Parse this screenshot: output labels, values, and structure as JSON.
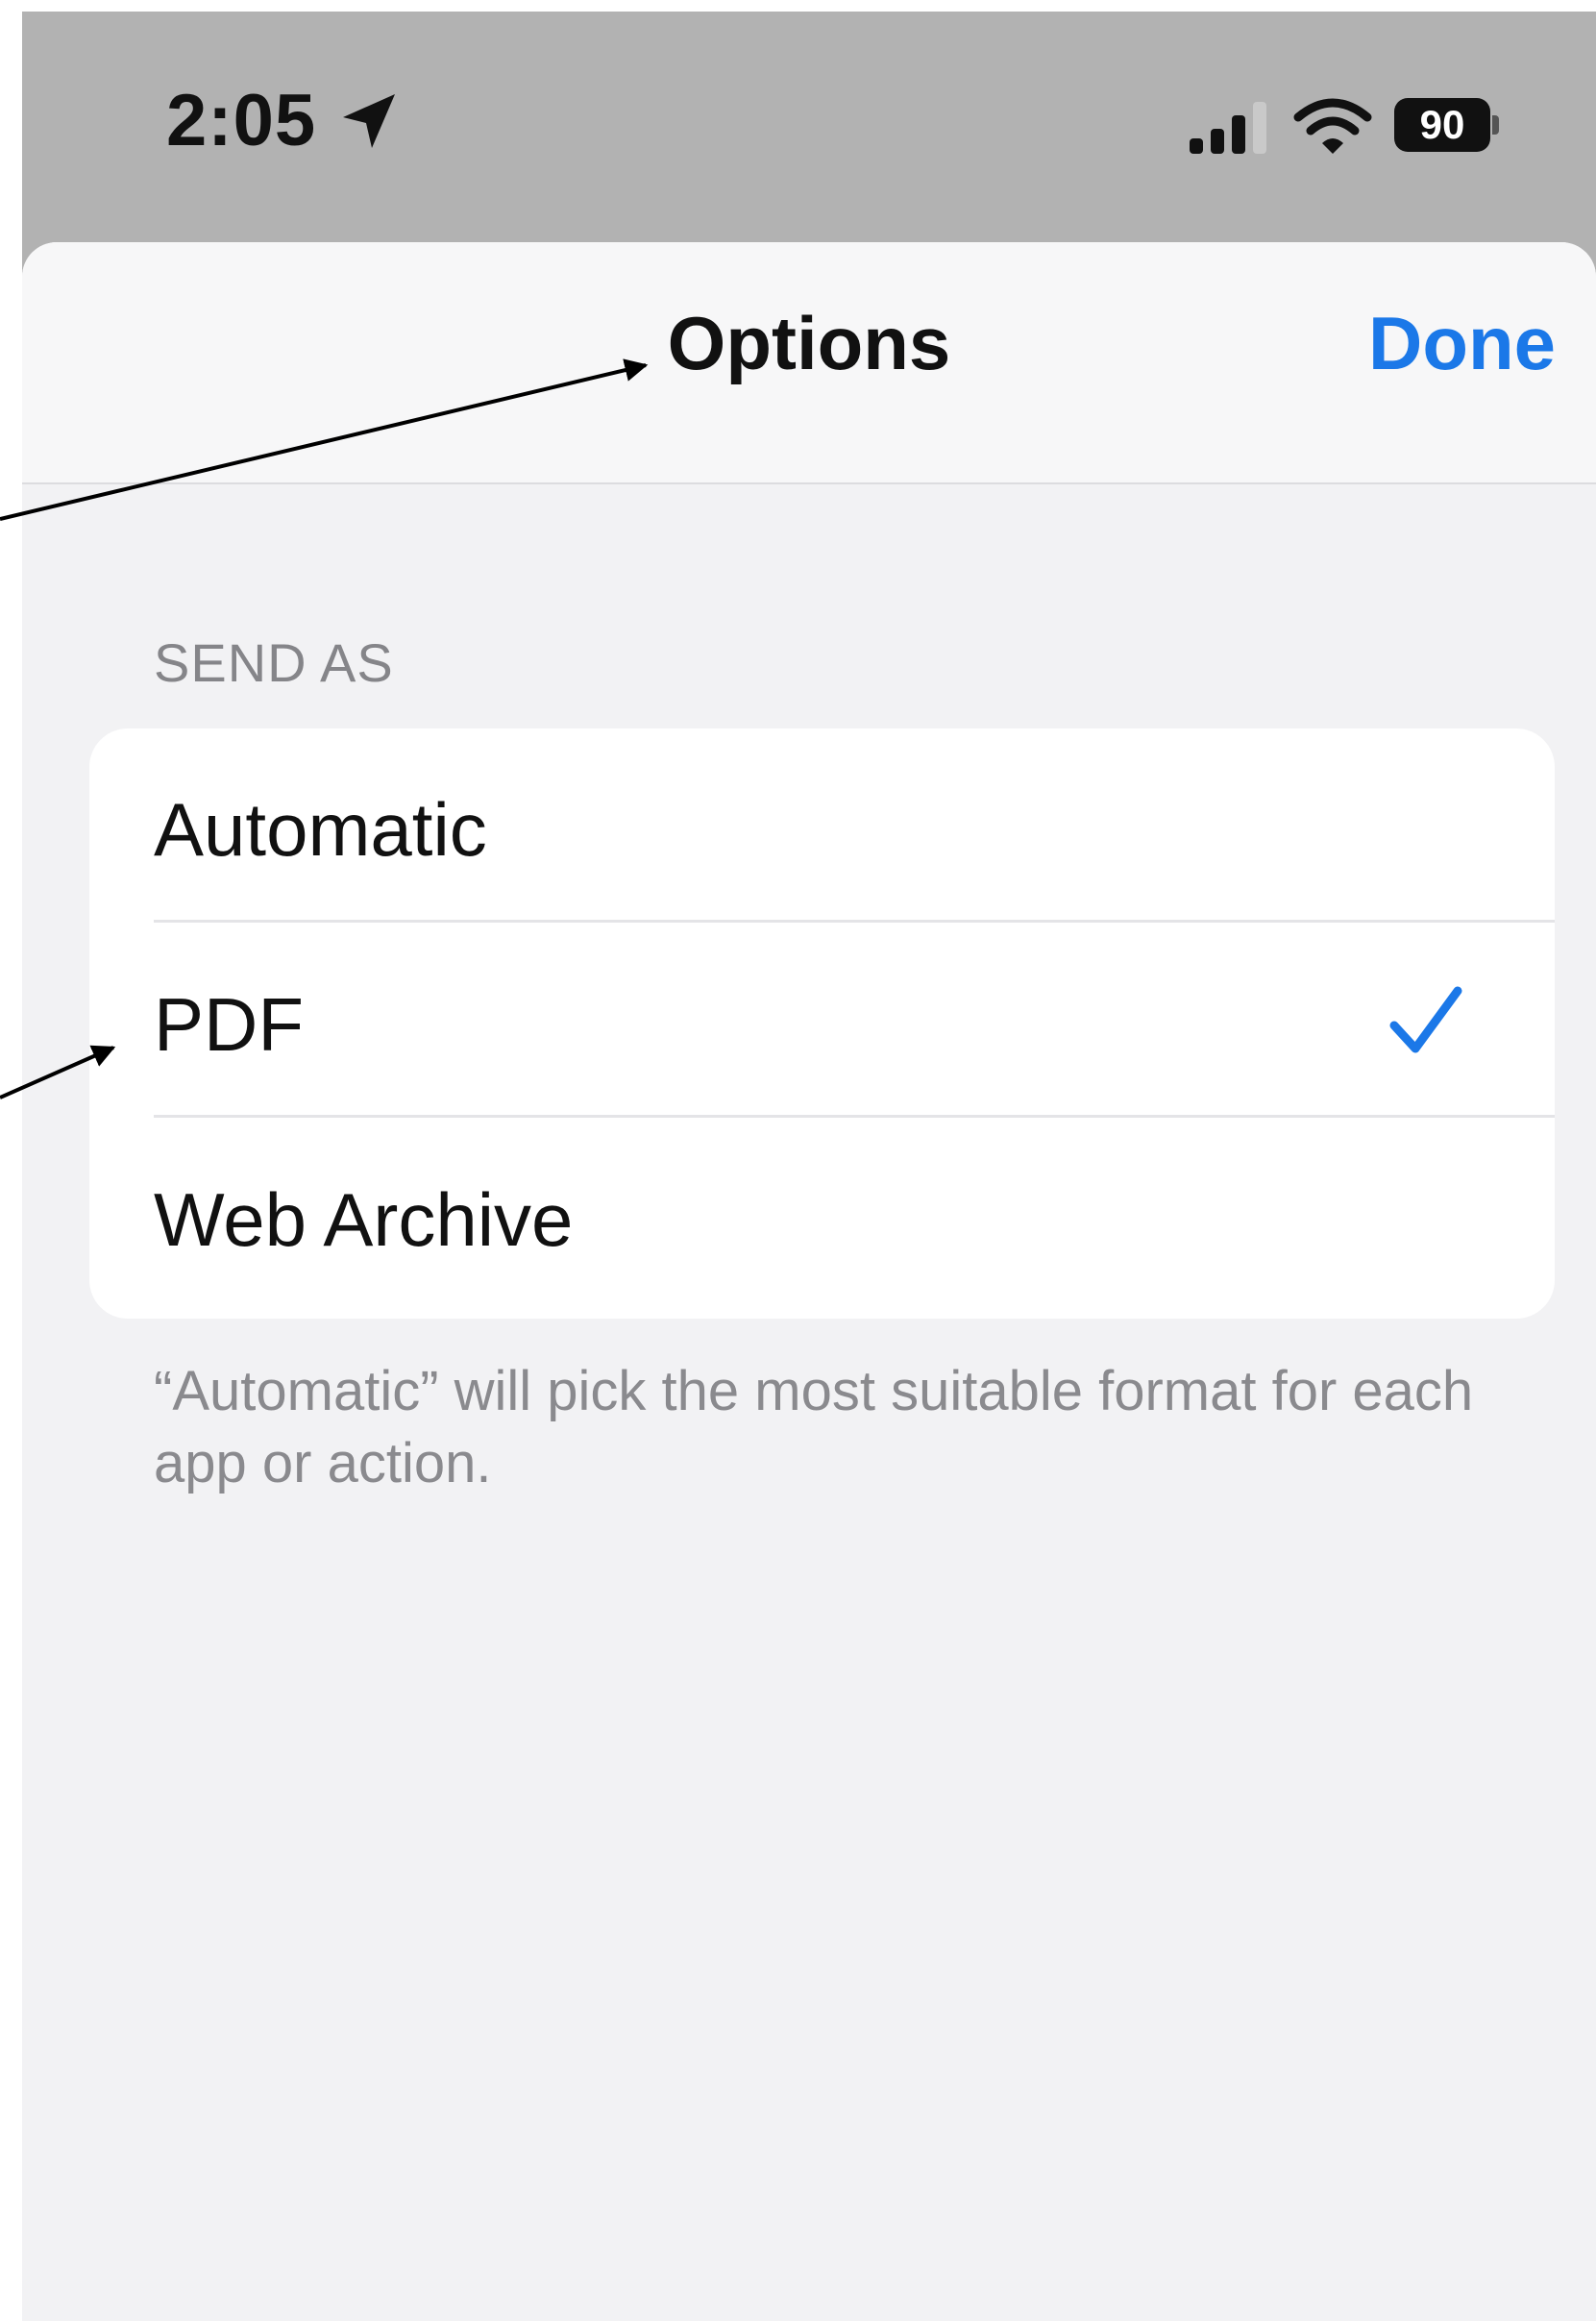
{
  "status_bar": {
    "time": "2:05",
    "battery": "90",
    "icons": [
      "location-arrow-icon",
      "cellular-signal-icon",
      "wifi-icon",
      "battery-icon"
    ]
  },
  "nav": {
    "title": "Options",
    "done_label": "Done"
  },
  "send_as": {
    "header": "SEND AS",
    "options": [
      {
        "label": "Automatic",
        "selected": false
      },
      {
        "label": "PDF",
        "selected": true
      },
      {
        "label": "Web Archive",
        "selected": false
      }
    ],
    "footer": "“Automatic” will pick the most suitable format for each app or action."
  },
  "colors": {
    "accent": "#1b78e8",
    "status_bar_bg": "#b2b2b2",
    "sheet_bg": "#f2f2f4",
    "annotation_arrow": "#000000"
  }
}
